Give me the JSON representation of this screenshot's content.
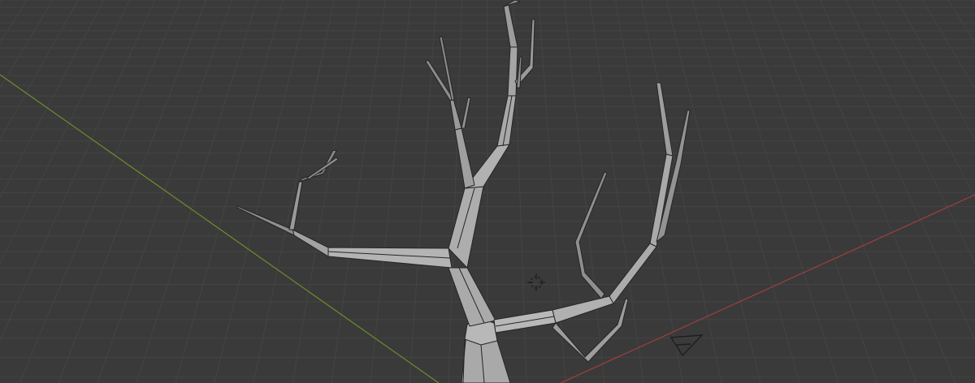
{
  "viewport": {
    "background_color": "#3a3a3a",
    "grid_minor_color": "#444444",
    "grid_major_color": "#4c4c4c",
    "x_axis_color": "#a23f3f",
    "y_axis_color": "#6c8f2c"
  },
  "scene": {
    "object_name": "tree",
    "object_type": "mesh",
    "mesh_fill_color": "#a9a9a9",
    "mesh_light_color": "#c6c6c6",
    "mesh_dark_color": "#6e6e6e",
    "wire_color": "#262626",
    "gizmos": [
      {
        "name": "3d-cursor-icon"
      },
      {
        "name": "camera-icon"
      }
    ]
  }
}
